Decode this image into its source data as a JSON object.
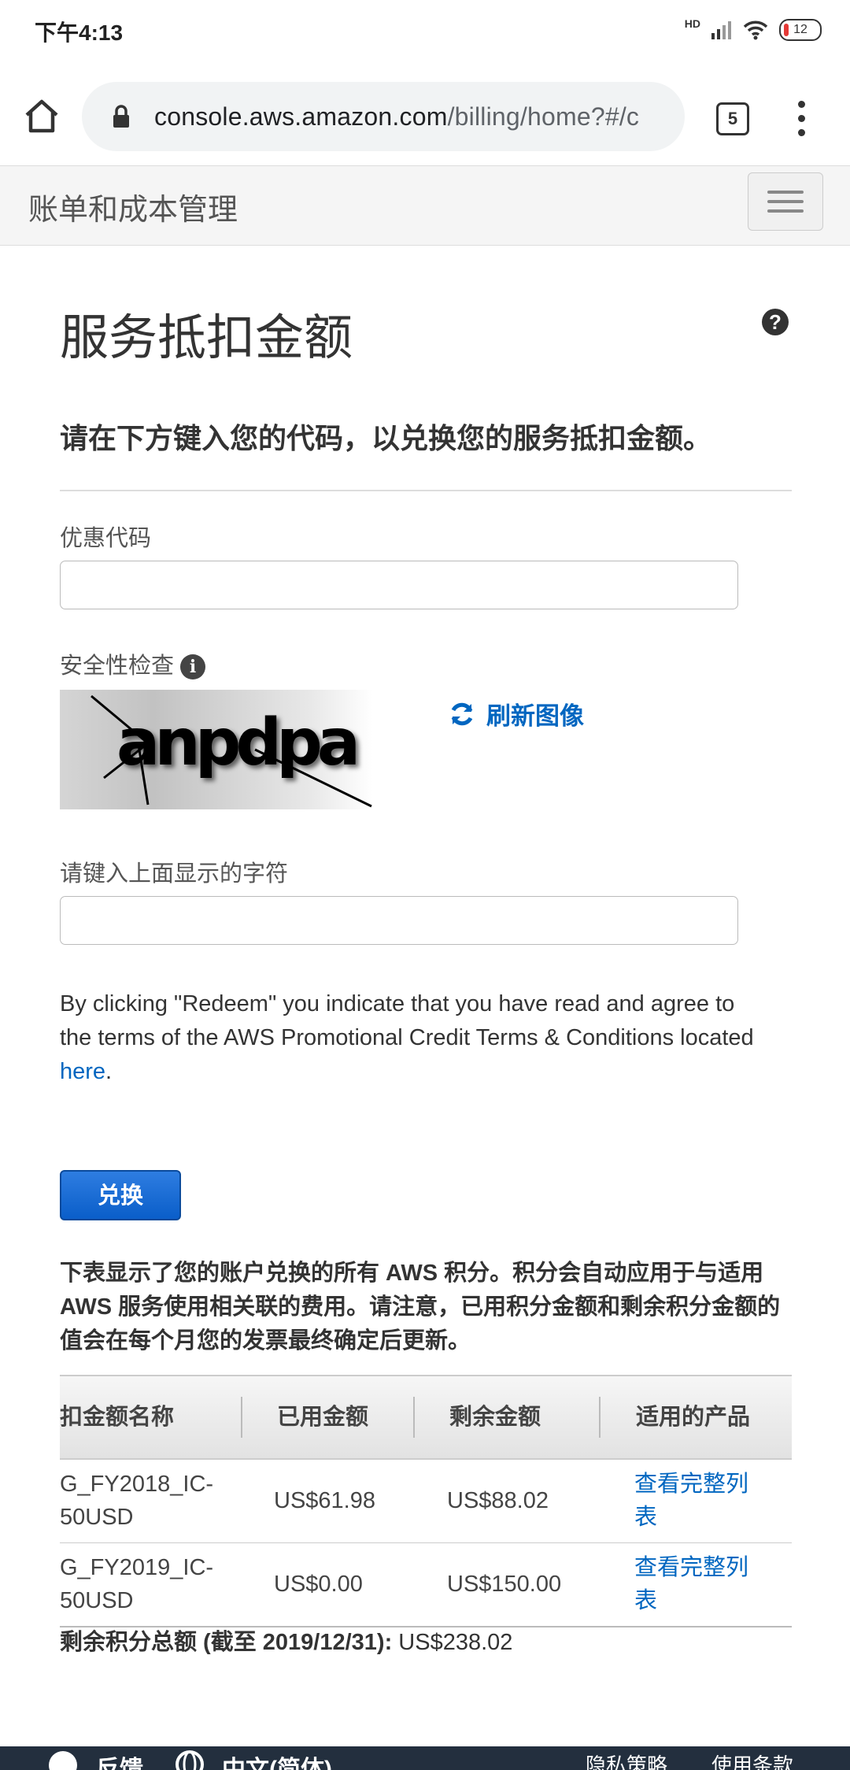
{
  "status_bar": {
    "time": "下午4:13",
    "network_label": "HD",
    "battery": "12"
  },
  "browser": {
    "url_domain": "console.aws.amazon.com",
    "url_path": "/billing/home?#/c",
    "tab_count": "5"
  },
  "console_header": {
    "title": "账单和成本管理"
  },
  "page": {
    "title": "服务抵扣金额",
    "help_icon": "?",
    "instruction": "请在下方键入您的代码，以兑换您的服务抵扣金额。",
    "promo_code_label": "优惠代码",
    "promo_code_value": "",
    "security_check_label": "安全性检查",
    "info_icon": "i",
    "captcha_text": "anpdpa",
    "refresh_label": "刷新图像",
    "captcha_input_label": "请键入上面显示的字符",
    "captcha_input_value": "",
    "legal_text": "By clicking \"Redeem\" you indicate that you have read and agree to the terms of the AWS Promotional Credit Terms & Conditions located ",
    "legal_link": "here",
    "legal_end": ".",
    "redeem_button": "兑换",
    "table_note": "下表显示了您的账户兑换的所有 AWS 积分。积分会自动应用于与适用 AWS 服务使用相关联的费用。请注意，已用积分金额和剩余积分金额的值会在每个月您的发票最终确定后更新。"
  },
  "credits_table": {
    "headers": [
      "扣金额名称",
      "已用金额",
      "剩余金额",
      "适用的产品"
    ],
    "rows": [
      {
        "name_line1": "G_FY2018_IC-",
        "name_line2": "50USD",
        "used": "US$61.98",
        "remaining": "US$88.02",
        "products_line1": "查看完整列",
        "products_line2": "表"
      },
      {
        "name_line1": "G_FY2019_IC-",
        "name_line2": "50USD",
        "used": "US$0.00",
        "remaining": "US$150.00",
        "products_line1": "查看完整列",
        "products_line2": "表"
      }
    ],
    "total_label": "剩余积分总额 (截至 2019/12/31):",
    "total_value": " US$238.02"
  },
  "footer": {
    "feedback": "反馈",
    "language": "中文(简体)",
    "privacy": "隐私策略",
    "terms": "使用条款"
  },
  "colors": {
    "link": "#0066c0",
    "button": "#0a5ec9",
    "footer_bg": "#232f3e"
  }
}
